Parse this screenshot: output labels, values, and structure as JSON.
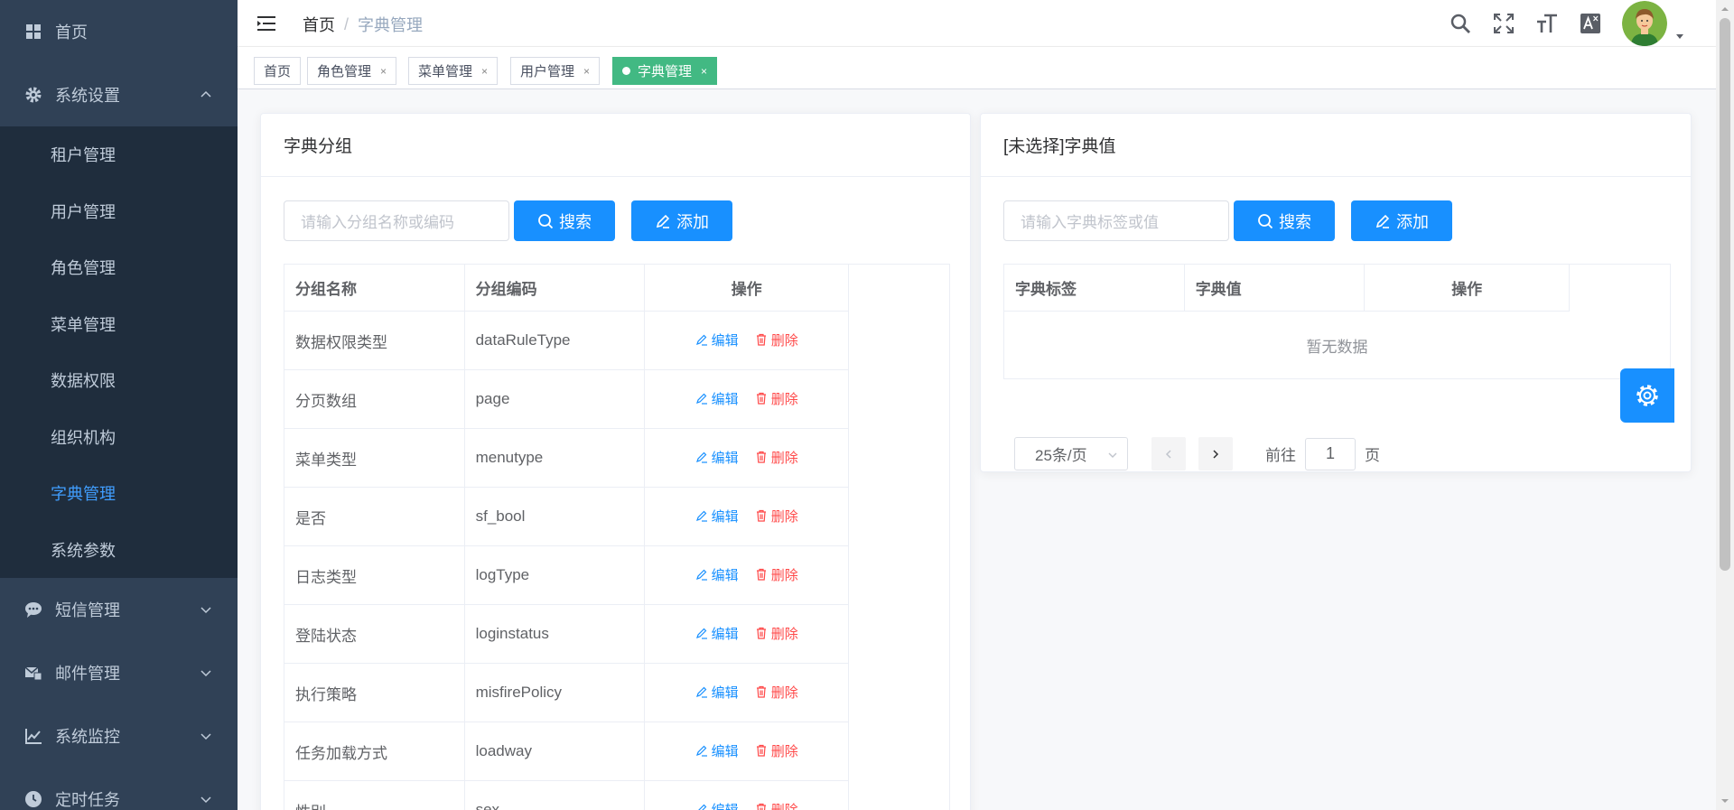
{
  "sidebar": {
    "items": [
      {
        "label": "首页",
        "icon": "dashboard-icon"
      },
      {
        "label": "系统设置",
        "icon": "gear-icon",
        "expanded": true
      },
      {
        "label": "短信管理",
        "icon": "message-icon"
      },
      {
        "label": "邮件管理",
        "icon": "mail-icon"
      },
      {
        "label": "系统监控",
        "icon": "monitor-chart-icon"
      },
      {
        "label": "定时任务",
        "icon": "clock-icon"
      }
    ],
    "submenu": [
      {
        "label": "租户管理"
      },
      {
        "label": "用户管理"
      },
      {
        "label": "角色管理"
      },
      {
        "label": "菜单管理"
      },
      {
        "label": "数据权限"
      },
      {
        "label": "组织机构"
      },
      {
        "label": "字典管理",
        "active": true
      },
      {
        "label": "系统参数"
      }
    ]
  },
  "navbar": {
    "breadcrumb_home": "首页",
    "breadcrumb_sep": "/",
    "breadcrumb_current": "字典管理"
  },
  "tags": [
    {
      "label": "首页",
      "closable": false
    },
    {
      "label": "角色管理",
      "closable": true
    },
    {
      "label": "菜单管理",
      "closable": true
    },
    {
      "label": "用户管理",
      "closable": true
    },
    {
      "label": "字典管理",
      "closable": true,
      "active": true
    }
  ],
  "tag_close_glyph": "×",
  "left_card": {
    "title": "字典分组",
    "search_placeholder": "请输入分组名称或编码",
    "search_label": "搜索",
    "add_label": "添加",
    "columns": [
      "分组名称",
      "分组编码",
      "操作"
    ],
    "rows": [
      {
        "name": "数据权限类型",
        "code": "dataRuleType"
      },
      {
        "name": "分页数组",
        "code": "page"
      },
      {
        "name": "菜单类型",
        "code": "menutype"
      },
      {
        "name": "是否",
        "code": "sf_bool"
      },
      {
        "name": "日志类型",
        "code": "logType"
      },
      {
        "name": "登陆状态",
        "code": "loginstatus"
      },
      {
        "name": "执行策略",
        "code": "misfirePolicy"
      },
      {
        "name": "任务加载方式",
        "code": "loadway"
      },
      {
        "name": "性别",
        "code": "sex"
      }
    ],
    "edit_label": "编辑",
    "delete_label": "删除"
  },
  "right_card": {
    "title": "[未选择]字典值",
    "search_placeholder": "请输入字典标签或值",
    "search_label": "搜索",
    "add_label": "添加",
    "columns": [
      "字典标签",
      "字典值",
      "操作"
    ],
    "empty_text": "暂无数据",
    "page_size": "25条/页",
    "goto_label": "前往",
    "page_value": "1",
    "page_unit": "页"
  },
  "colors": {
    "sidebar_bg": "#304156",
    "submenu_bg": "#1f2d3d",
    "active_menu": "#409eff",
    "primary": "#1890ff",
    "active_tag": "#42b983",
    "danger": "#ff4949"
  }
}
